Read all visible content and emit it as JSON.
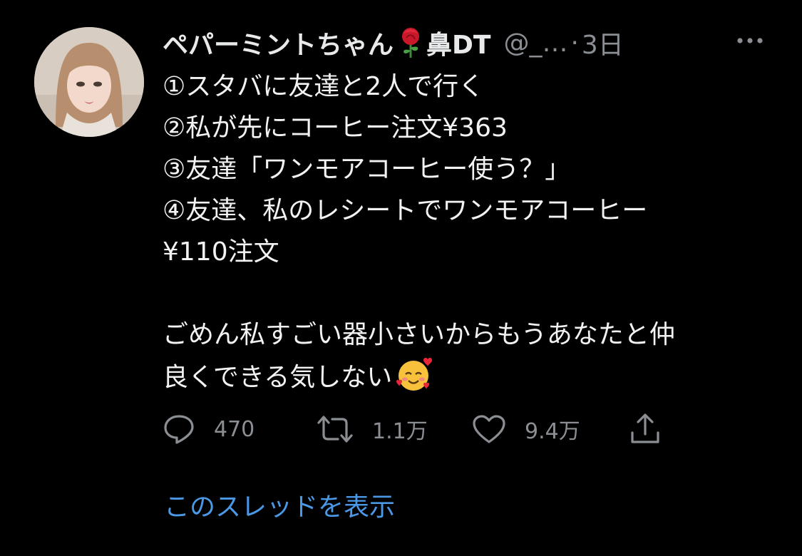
{
  "tweet": {
    "display_name": "ペパーミントちゃん",
    "display_name_suffix": "鼻DT",
    "handle": "@_…",
    "separator": "·",
    "time": "3日",
    "body_lines": [
      "①スタバに友達と2人で行く",
      "②私が先にコーヒー注文¥363",
      "③友達「ワンモアコーヒー使う？」",
      "④友達、私のレシートでワンモアコーヒー",
      "¥110注文",
      "",
      "ごめん私すごい器小さいからもうあなたと仲",
      "良くできる気しない"
    ],
    "icons": {
      "name_emoji": "rose-icon",
      "body_emoji": "smiling-face-with-hearts-icon",
      "more": "more-icon",
      "reply": "reply-icon",
      "retweet": "retweet-icon",
      "like": "heart-icon",
      "share": "share-icon"
    },
    "stats": {
      "replies": "470",
      "retweets": "1.1万",
      "likes": "9.4万"
    },
    "show_thread": "このスレッドを表示"
  },
  "colors": {
    "background": "#000000",
    "text": "#e7e9ea",
    "secondary": "#8b8f94",
    "link": "#4a98e6"
  }
}
